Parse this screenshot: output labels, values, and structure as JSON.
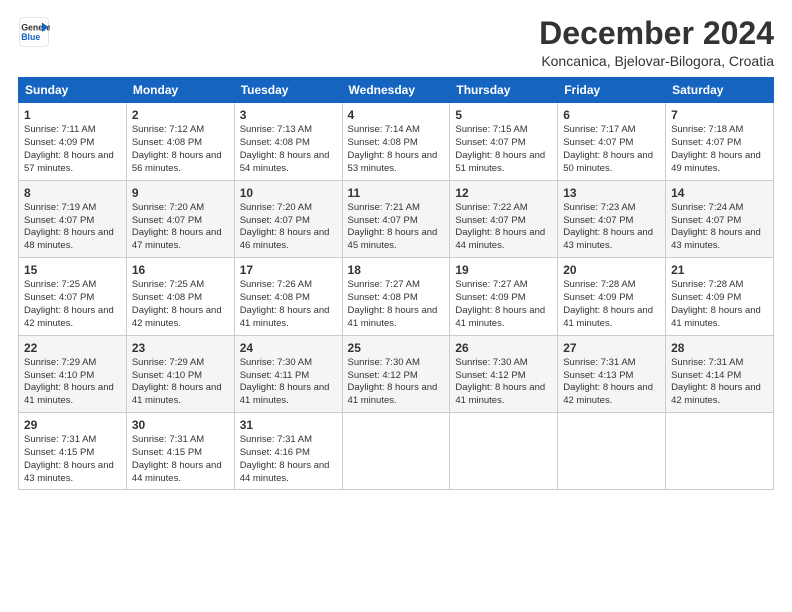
{
  "logo": {
    "line1": "General",
    "line2": "Blue"
  },
  "title": "December 2024",
  "subtitle": "Koncanica, Bjelovar-Bilogora, Croatia",
  "days": [
    "Sunday",
    "Monday",
    "Tuesday",
    "Wednesday",
    "Thursday",
    "Friday",
    "Saturday"
  ],
  "weeks": [
    [
      {
        "day": 1,
        "sunrise": "7:11 AM",
        "sunset": "4:09 PM",
        "daylight": "8 hours and 57 minutes."
      },
      {
        "day": 2,
        "sunrise": "7:12 AM",
        "sunset": "4:08 PM",
        "daylight": "8 hours and 56 minutes."
      },
      {
        "day": 3,
        "sunrise": "7:13 AM",
        "sunset": "4:08 PM",
        "daylight": "8 hours and 54 minutes."
      },
      {
        "day": 4,
        "sunrise": "7:14 AM",
        "sunset": "4:08 PM",
        "daylight": "8 hours and 53 minutes."
      },
      {
        "day": 5,
        "sunrise": "7:15 AM",
        "sunset": "4:07 PM",
        "daylight": "8 hours and 51 minutes."
      },
      {
        "day": 6,
        "sunrise": "7:17 AM",
        "sunset": "4:07 PM",
        "daylight": "8 hours and 50 minutes."
      },
      {
        "day": 7,
        "sunrise": "7:18 AM",
        "sunset": "4:07 PM",
        "daylight": "8 hours and 49 minutes."
      }
    ],
    [
      {
        "day": 8,
        "sunrise": "7:19 AM",
        "sunset": "4:07 PM",
        "daylight": "8 hours and 48 minutes."
      },
      {
        "day": 9,
        "sunrise": "7:20 AM",
        "sunset": "4:07 PM",
        "daylight": "8 hours and 47 minutes."
      },
      {
        "day": 10,
        "sunrise": "7:20 AM",
        "sunset": "4:07 PM",
        "daylight": "8 hours and 46 minutes."
      },
      {
        "day": 11,
        "sunrise": "7:21 AM",
        "sunset": "4:07 PM",
        "daylight": "8 hours and 45 minutes."
      },
      {
        "day": 12,
        "sunrise": "7:22 AM",
        "sunset": "4:07 PM",
        "daylight": "8 hours and 44 minutes."
      },
      {
        "day": 13,
        "sunrise": "7:23 AM",
        "sunset": "4:07 PM",
        "daylight": "8 hours and 43 minutes."
      },
      {
        "day": 14,
        "sunrise": "7:24 AM",
        "sunset": "4:07 PM",
        "daylight": "8 hours and 43 minutes."
      }
    ],
    [
      {
        "day": 15,
        "sunrise": "7:25 AM",
        "sunset": "4:07 PM",
        "daylight": "8 hours and 42 minutes."
      },
      {
        "day": 16,
        "sunrise": "7:25 AM",
        "sunset": "4:08 PM",
        "daylight": "8 hours and 42 minutes."
      },
      {
        "day": 17,
        "sunrise": "7:26 AM",
        "sunset": "4:08 PM",
        "daylight": "8 hours and 41 minutes."
      },
      {
        "day": 18,
        "sunrise": "7:27 AM",
        "sunset": "4:08 PM",
        "daylight": "8 hours and 41 minutes."
      },
      {
        "day": 19,
        "sunrise": "7:27 AM",
        "sunset": "4:09 PM",
        "daylight": "8 hours and 41 minutes."
      },
      {
        "day": 20,
        "sunrise": "7:28 AM",
        "sunset": "4:09 PM",
        "daylight": "8 hours and 41 minutes."
      },
      {
        "day": 21,
        "sunrise": "7:28 AM",
        "sunset": "4:09 PM",
        "daylight": "8 hours and 41 minutes."
      }
    ],
    [
      {
        "day": 22,
        "sunrise": "7:29 AM",
        "sunset": "4:10 PM",
        "daylight": "8 hours and 41 minutes."
      },
      {
        "day": 23,
        "sunrise": "7:29 AM",
        "sunset": "4:10 PM",
        "daylight": "8 hours and 41 minutes."
      },
      {
        "day": 24,
        "sunrise": "7:30 AM",
        "sunset": "4:11 PM",
        "daylight": "8 hours and 41 minutes."
      },
      {
        "day": 25,
        "sunrise": "7:30 AM",
        "sunset": "4:12 PM",
        "daylight": "8 hours and 41 minutes."
      },
      {
        "day": 26,
        "sunrise": "7:30 AM",
        "sunset": "4:12 PM",
        "daylight": "8 hours and 41 minutes."
      },
      {
        "day": 27,
        "sunrise": "7:31 AM",
        "sunset": "4:13 PM",
        "daylight": "8 hours and 42 minutes."
      },
      {
        "day": 28,
        "sunrise": "7:31 AM",
        "sunset": "4:14 PM",
        "daylight": "8 hours and 42 minutes."
      }
    ],
    [
      {
        "day": 29,
        "sunrise": "7:31 AM",
        "sunset": "4:15 PM",
        "daylight": "8 hours and 43 minutes."
      },
      {
        "day": 30,
        "sunrise": "7:31 AM",
        "sunset": "4:15 PM",
        "daylight": "8 hours and 44 minutes."
      },
      {
        "day": 31,
        "sunrise": "7:31 AM",
        "sunset": "4:16 PM",
        "daylight": "8 hours and 44 minutes."
      },
      null,
      null,
      null,
      null
    ]
  ]
}
